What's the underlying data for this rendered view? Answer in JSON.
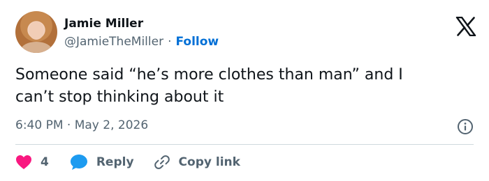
{
  "author": {
    "name": "Jamie Miller",
    "handle": "@JamieTheMiller",
    "separator": "·",
    "follow_label": "Follow"
  },
  "tweet": {
    "text": "Someone said “he’s more clothes than man” and I\ncan’t stop thinking about it",
    "time": "6:40 PM · May 2, 2026"
  },
  "actions": {
    "like_count": "4",
    "reply_label": "Reply",
    "copy_label": "Copy link"
  },
  "colors": {
    "like": "#f91880",
    "reply": "#1d9bf0",
    "follow": "#006fd6",
    "secondary": "#536471"
  },
  "icons": [
    "x-logo-icon",
    "info-icon",
    "heart-icon",
    "reply-bubble-icon",
    "link-icon"
  ]
}
